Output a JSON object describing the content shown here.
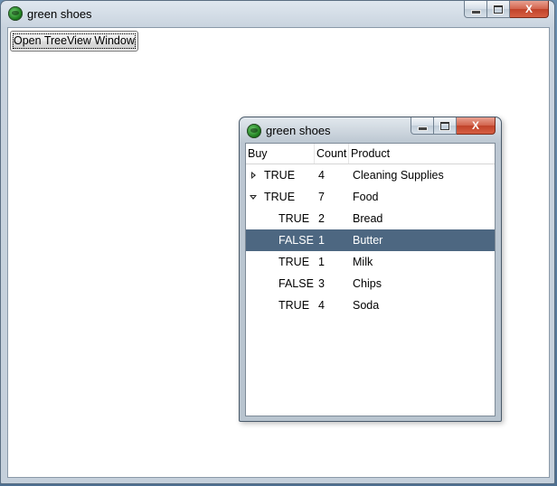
{
  "main_window": {
    "title": "green shoes",
    "open_button_label": "Open TreeView Window",
    "close_glyph": "X"
  },
  "treeview_window": {
    "title": "green shoes",
    "close_glyph": "X",
    "columns": {
      "buy": "Buy",
      "count": "Count",
      "product": "Product"
    },
    "rows": [
      {
        "buy": "TRUE",
        "count": "4",
        "product": "Cleaning Supplies",
        "level": 0,
        "expander": "collapsed",
        "selected": false
      },
      {
        "buy": "TRUE",
        "count": "7",
        "product": "Food",
        "level": 0,
        "expander": "expanded",
        "selected": false
      },
      {
        "buy": "TRUE",
        "count": "2",
        "product": "Bread",
        "level": 1,
        "expander": "none",
        "selected": false
      },
      {
        "buy": "FALSE",
        "count": "1",
        "product": "Butter",
        "level": 1,
        "expander": "none",
        "selected": true
      },
      {
        "buy": "TRUE",
        "count": "1",
        "product": "Milk",
        "level": 1,
        "expander": "none",
        "selected": false
      },
      {
        "buy": "FALSE",
        "count": "3",
        "product": "Chips",
        "level": 1,
        "expander": "none",
        "selected": false
      },
      {
        "buy": "TRUE",
        "count": "4",
        "product": "Soda",
        "level": 1,
        "expander": "none",
        "selected": false
      }
    ]
  },
  "icons": {
    "app": "green-shoes-app-icon",
    "minimize": "minimize-icon",
    "maximize": "maximize-icon",
    "close": "close-icon",
    "collapsed": "expand-arrow-icon",
    "expanded": "collapse-arrow-icon"
  },
  "colors": {
    "selection": "#4d6781",
    "close_button": "#c0432a",
    "desktop": "#5b7fa0"
  }
}
